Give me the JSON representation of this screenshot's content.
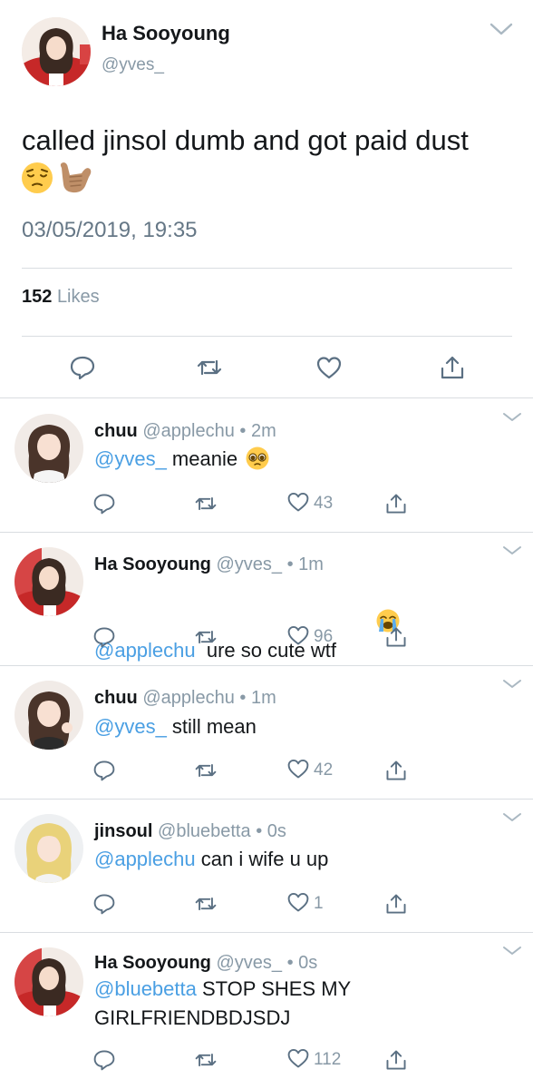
{
  "main_tweet": {
    "author_name": "Ha Sooyoung",
    "author_handle": "@yves_",
    "text": "called jinsol dumb and got paid dust",
    "emojis": [
      "pensive-face-emoji",
      "call-me-hand-emoji"
    ],
    "timestamp": "03/05/2019, 19:35",
    "likes_count": "152",
    "likes_label": "Likes"
  },
  "replies": [
    {
      "name": "chuu",
      "handle": "@applechu",
      "time": "2m",
      "mention": "@yves_",
      "text": " meanie",
      "emoji": "pleading-face-emoji",
      "like_count": "43"
    },
    {
      "name": "Ha Sooyoung",
      "handle": "@yves_",
      "time": "1m",
      "mention": "@applechu",
      "text": "  ure so cute wtf",
      "emoji": "loudly-crying-face-emoji",
      "like_count": "96"
    },
    {
      "name": "chuu",
      "handle": "@applechu",
      "time": "1m",
      "mention": "@yves_",
      "text": " still mean",
      "like_count": "42"
    },
    {
      "name": "jinsoul",
      "handle": "@bluebetta",
      "time": "0s",
      "mention": "@applechu",
      "text": " can i wife u up",
      "like_count": "1"
    },
    {
      "name": "Ha Sooyoung",
      "handle": "@yves_",
      "time": "0s",
      "mention": "@bluebetta",
      "text": " STOP SHES MY GIRLFRIENDBDJSDJ",
      "like_count": "112"
    }
  ],
  "meta_separator": "•",
  "colors": {
    "text": "#14171a",
    "secondary": "#8899a6",
    "timestamp": "#657786",
    "mention": "#4a9fe3",
    "divider": "#d9dde1",
    "icon": "#5b7083"
  },
  "icons": [
    "chevron-down-icon",
    "reply-icon",
    "retweet-icon",
    "like-icon",
    "share-icon"
  ]
}
